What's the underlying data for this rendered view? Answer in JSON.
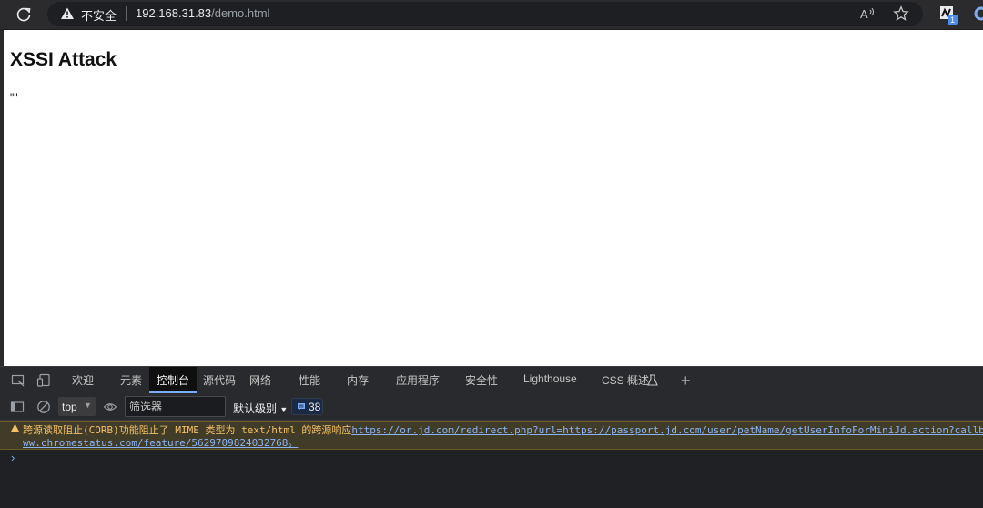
{
  "browser": {
    "security_label": "不安全",
    "url_host": "192.168.31.83",
    "url_path": "/demo.html",
    "extension_badge": "1"
  },
  "page": {
    "heading": "XSSI Attack",
    "paragraph": "\"\""
  },
  "devtools": {
    "tabs": [
      "欢迎",
      "元素",
      "控制台",
      "源代码",
      "网络",
      "性能",
      "内存",
      "应用程序",
      "安全性",
      "Lighthouse",
      "CSS 概述"
    ],
    "active_tab": "控制台",
    "context": "top",
    "filter_placeholder": "筛选器",
    "levels": "默认级别",
    "message_count": "38",
    "warning": {
      "text": "跨源读取阻止(CORB)功能阻止了 MIME 类型为 text/html 的跨源响应",
      "link1": "https://or.jd.com/redirect.php?url=https://passport.jd.com/user/petName/getUserInfoForMiniJd.action?callba",
      "link2": "ww.chromestatus.com/feature/5629709824032768。"
    },
    "prompt": "›"
  },
  "colors": {
    "warning_bg": "#413c27",
    "warning_text": "#f4c067",
    "link": "#8ab4f8",
    "accent": "#7cacf8"
  }
}
